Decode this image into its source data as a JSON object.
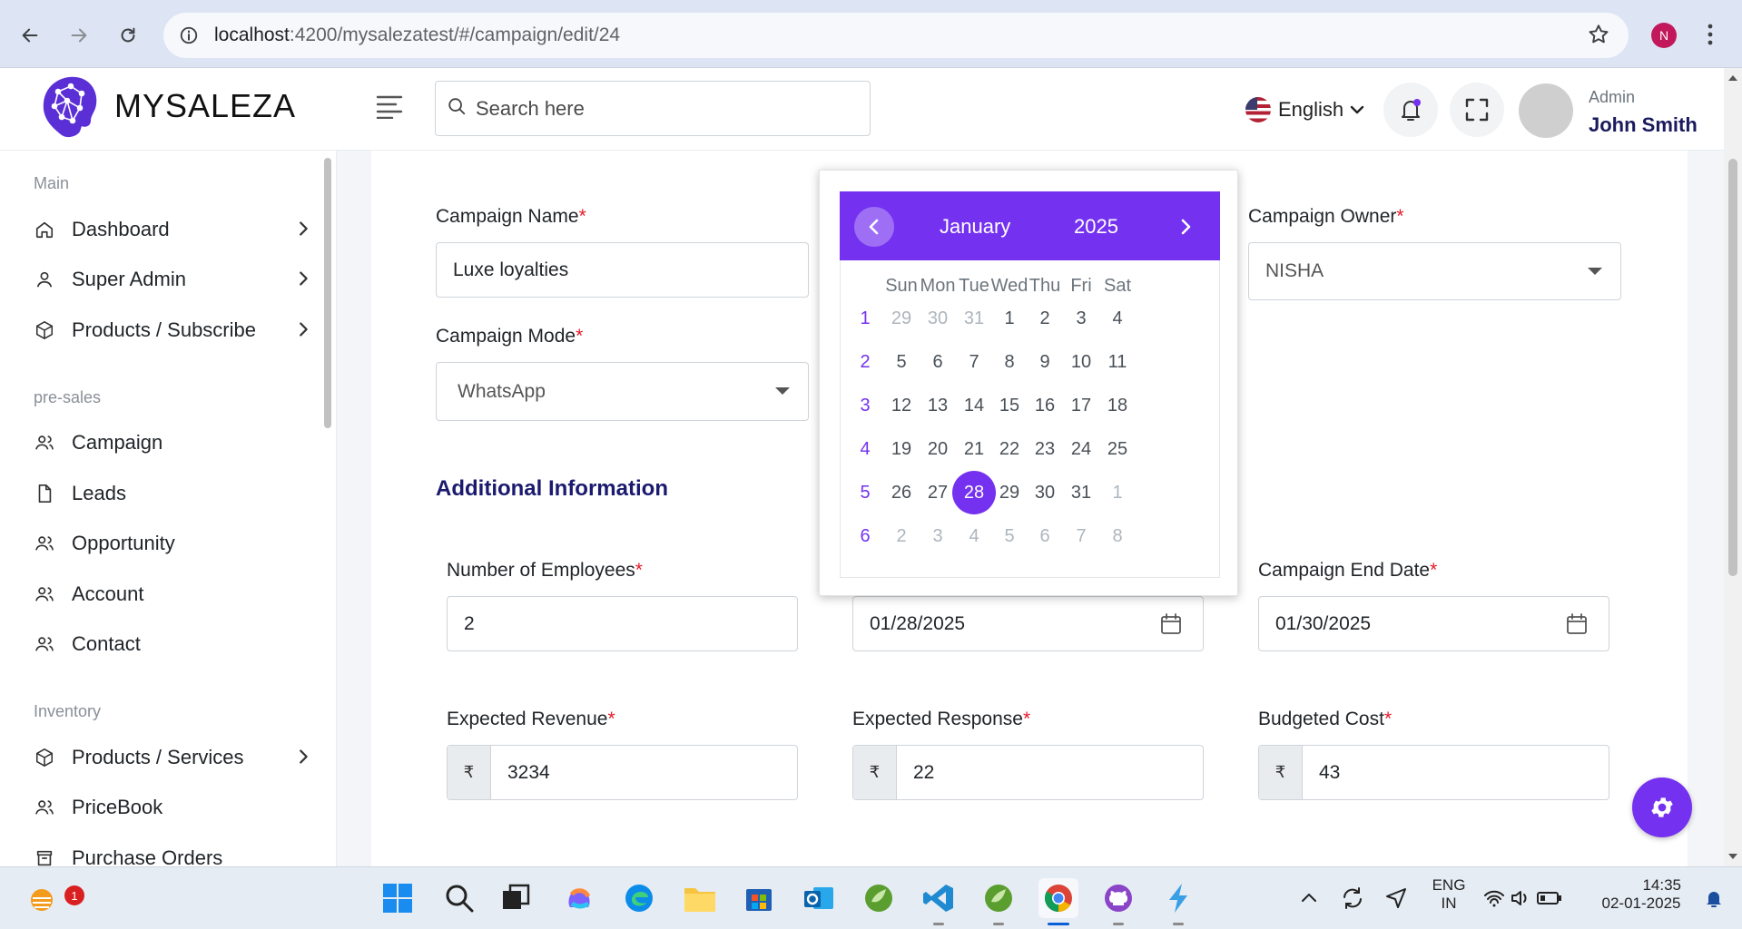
{
  "browser": {
    "url_host": "localhost",
    "url_path": ":4200/mysalezatest/#/campaign/edit/24",
    "profile_initial": "N"
  },
  "header": {
    "logo_text": "MYSALEZA",
    "search_placeholder": "Search here",
    "language": "English",
    "user_role": "Admin",
    "user_name": "John Smith"
  },
  "sidebar": {
    "sections": [
      {
        "title": "Main"
      },
      {
        "title": "pre-sales"
      },
      {
        "title": "Inventory"
      }
    ],
    "items": [
      {
        "label": "Dashboard",
        "icon": "home-icon"
      },
      {
        "label": "Super Admin",
        "icon": "user-icon"
      },
      {
        "label": "Products / Subscribe",
        "icon": "box-icon"
      },
      {
        "label": "Campaign",
        "icon": "users-icon"
      },
      {
        "label": "Leads",
        "icon": "file-icon"
      },
      {
        "label": "Opportunity",
        "icon": "users-icon"
      },
      {
        "label": "Account",
        "icon": "users-icon"
      },
      {
        "label": "Contact",
        "icon": "users-icon"
      },
      {
        "label": "Products / Services",
        "icon": "box-icon"
      },
      {
        "label": "PriceBook",
        "icon": "users-icon"
      },
      {
        "label": "Purchase Orders",
        "icon": "cart-icon"
      }
    ]
  },
  "form": {
    "campaign_name_label": "Campaign Name",
    "campaign_name_value": "Luxe loyalties",
    "campaign_mode_label": "Campaign Mode",
    "campaign_mode_value": "WhatsApp",
    "campaign_owner_label": "Campaign Owner",
    "campaign_owner_value": "NISHA",
    "additional_info_title": "Additional Information",
    "employees_label": "Number of Employees",
    "employees_value": "2",
    "start_date_value": "01/28/2025",
    "end_date_label": "Campaign End Date",
    "end_date_value": "01/30/2025",
    "revenue_label": "Expected Revenue",
    "revenue_value": "3234",
    "response_label": "Expected Response",
    "response_value": "22",
    "budget_label": "Budgeted Cost",
    "budget_value": "43",
    "currency_symbol": "₹",
    "required_mark": "*"
  },
  "datepicker": {
    "month": "January",
    "year": "2025",
    "weekdays": [
      "Sun",
      "Mon",
      "Tue",
      "Wed",
      "Thu",
      "Fri",
      "Sat"
    ],
    "weeks": [
      {
        "week": "1",
        "days": [
          {
            "d": "29",
            "m": true
          },
          {
            "d": "30",
            "m": true
          },
          {
            "d": "31",
            "m": true
          },
          {
            "d": "1"
          },
          {
            "d": "2"
          },
          {
            "d": "3"
          },
          {
            "d": "4"
          }
        ]
      },
      {
        "week": "2",
        "days": [
          {
            "d": "5"
          },
          {
            "d": "6"
          },
          {
            "d": "7"
          },
          {
            "d": "8"
          },
          {
            "d": "9"
          },
          {
            "d": "10"
          },
          {
            "d": "11"
          }
        ]
      },
      {
        "week": "3",
        "days": [
          {
            "d": "12"
          },
          {
            "d": "13"
          },
          {
            "d": "14"
          },
          {
            "d": "15"
          },
          {
            "d": "16"
          },
          {
            "d": "17"
          },
          {
            "d": "18"
          }
        ]
      },
      {
        "week": "4",
        "days": [
          {
            "d": "19"
          },
          {
            "d": "20"
          },
          {
            "d": "21"
          },
          {
            "d": "22"
          },
          {
            "d": "23"
          },
          {
            "d": "24"
          },
          {
            "d": "25"
          }
        ]
      },
      {
        "week": "5",
        "days": [
          {
            "d": "26"
          },
          {
            "d": "27"
          },
          {
            "d": "28",
            "s": true
          },
          {
            "d": "29"
          },
          {
            "d": "30"
          },
          {
            "d": "31"
          },
          {
            "d": "1",
            "m": true
          }
        ]
      },
      {
        "week": "6",
        "days": [
          {
            "d": "2",
            "m": true
          },
          {
            "d": "3",
            "m": true
          },
          {
            "d": "4",
            "m": true
          },
          {
            "d": "5",
            "m": true
          },
          {
            "d": "6",
            "m": true
          },
          {
            "d": "7",
            "m": true
          },
          {
            "d": "8",
            "m": true
          }
        ]
      }
    ],
    "accent_color": "#7431f0"
  },
  "taskbar": {
    "notification_count": "1",
    "lang_line1": "ENG",
    "lang_line2": "IN",
    "time": "14:35",
    "date": "02-01-2025"
  }
}
